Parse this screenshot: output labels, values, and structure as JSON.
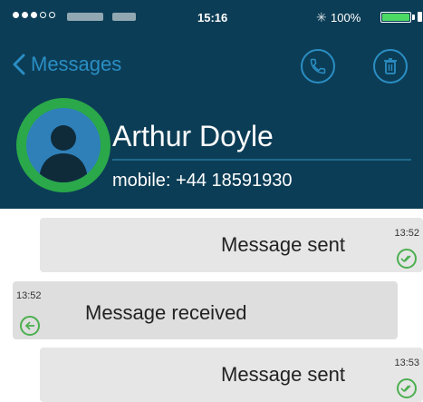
{
  "status_bar": {
    "time": "15:16",
    "battery_text": "100%",
    "battery_level": 1.0,
    "signal_dots_filled": 3,
    "signal_dots_total": 5,
    "icons": [
      "signal-dots-icon",
      "bluetooth-icon",
      "battery-icon"
    ]
  },
  "nav": {
    "back_label": "Messages",
    "icons": [
      "chevron-left-icon",
      "phone-icon",
      "trash-icon"
    ],
    "accent_color": "#2a8ec4"
  },
  "contact": {
    "name": "Arthur Doyle",
    "mobile": "mobile: +44 18591930",
    "ring_color": "#2aa84a"
  },
  "messages": [
    {
      "direction": "sent",
      "text": "Message sent",
      "time": "13:52",
      "status_icon": "double-check-icon"
    },
    {
      "direction": "received",
      "text": "Message received",
      "time": "13:52",
      "status_icon": "arrow-left-circle-icon"
    },
    {
      "direction": "sent",
      "text": "Message sent",
      "time": "13:53",
      "status_icon": "double-check-icon"
    }
  ],
  "colors": {
    "header_bg": "#0c3d56",
    "sent_bubble": "#e6e6e6",
    "received_bubble": "#dedede",
    "status_green": "#4caf50"
  }
}
